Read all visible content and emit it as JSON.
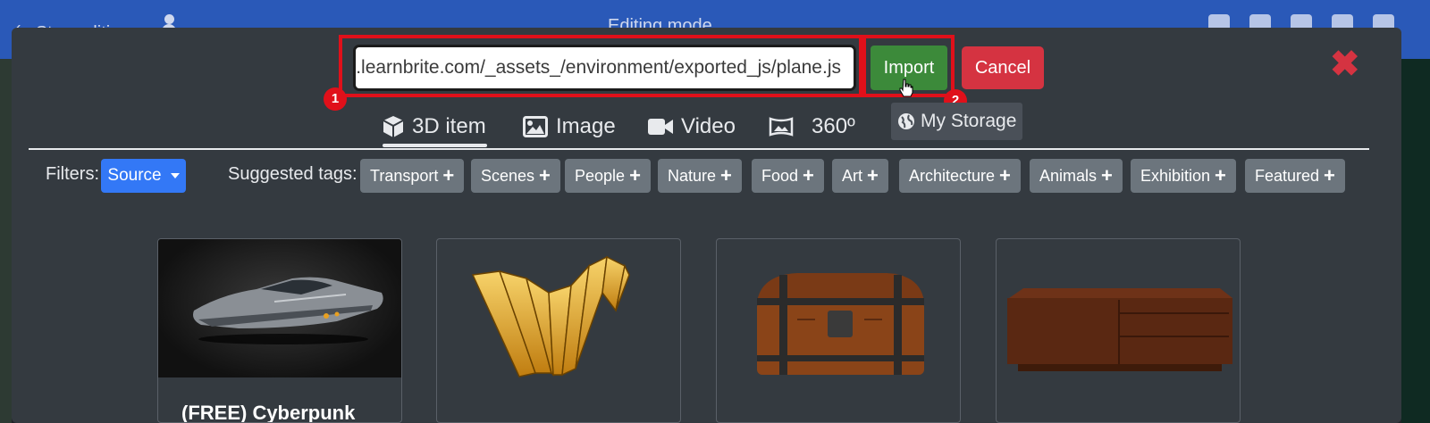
{
  "topbar": {
    "stop_label": "Stop editing",
    "title": "Editing mode"
  },
  "import_bar": {
    "url_value": "e.learnbrite.com/_assets_/environment/exported_js/plane.js",
    "import_label": "Import",
    "cancel_label": "Cancel",
    "annotations": [
      "1",
      "2"
    ]
  },
  "tabs": [
    {
      "label": "3D item",
      "icon": "cube-icon",
      "active": true
    },
    {
      "label": "Image",
      "icon": "image-icon"
    },
    {
      "label": "Video",
      "icon": "video-camera-icon"
    },
    {
      "label": "360º",
      "icon": "panorama-icon"
    },
    {
      "label": "My Storage",
      "icon": "globe-icon"
    }
  ],
  "filters": {
    "label": "Filters:",
    "source_label": "Source",
    "suggested_label": "Suggested tags:",
    "tags": [
      "Transport",
      "Scenes",
      "People",
      "Nature",
      "Food",
      "Art",
      "Architecture",
      "Animals",
      "Exhibition",
      "Featured"
    ]
  },
  "cards": [
    {
      "title": "(FREE) Cyberpunk",
      "thumb": "cyberpunk-hover-car"
    },
    {
      "title": "",
      "thumb": "golden-folding-screens"
    },
    {
      "title": "",
      "thumb": "wooden-treasure-chest"
    },
    {
      "title": "",
      "thumb": "wooden-tv-cabinet"
    }
  ],
  "colors": {
    "topbar": "#2a59b8",
    "modal_bg": "#343a40",
    "import_green": "#3c8a3a",
    "cancel_red": "#d53341",
    "source_blue": "#3378f6",
    "tag_grey": "#6c757d",
    "highlight_red": "#e0101a"
  }
}
